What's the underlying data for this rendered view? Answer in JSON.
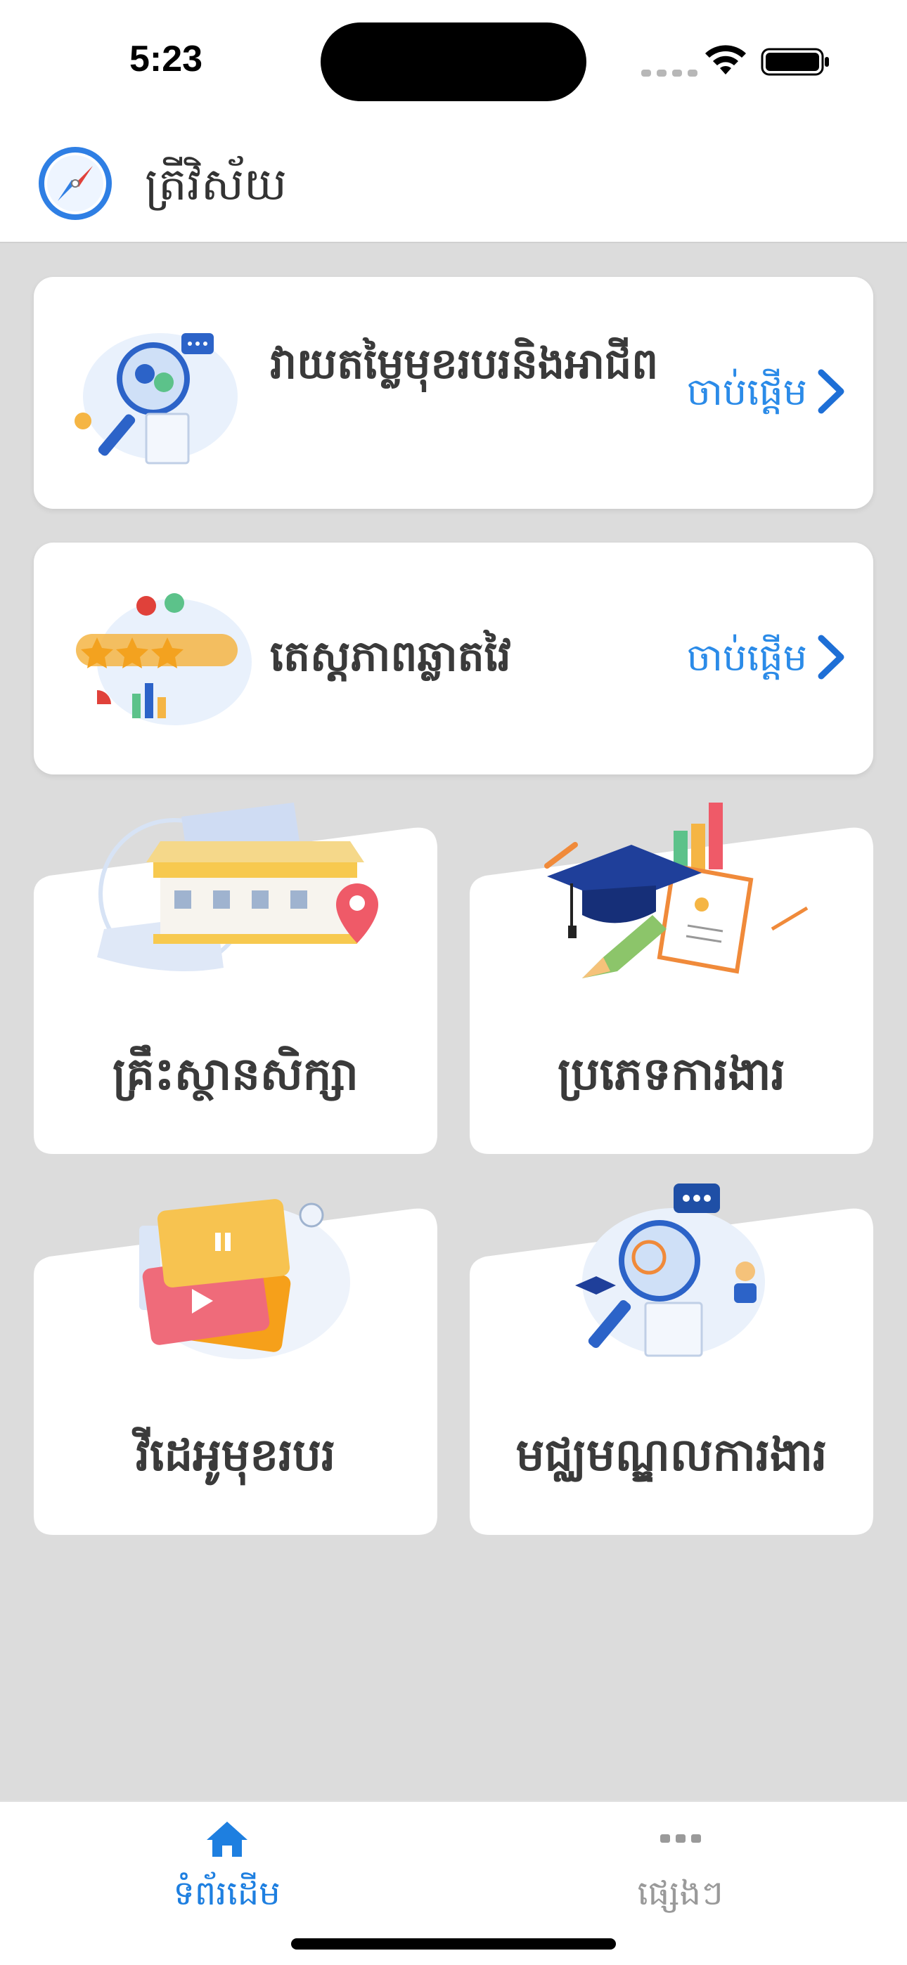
{
  "status_bar": {
    "time": "5:23"
  },
  "header": {
    "title": "ត្រីវិស័យ",
    "icon": "compass-icon"
  },
  "wide_cards": [
    {
      "title": "វាយតម្លៃមុខរបរនិងអាជីព",
      "action": "ចាប់ផ្តើម",
      "illustration": "career-assessment-illustration"
    },
    {
      "title": "តេស្តភាពឆ្លាតវៃ",
      "action": "ចាប់ផ្តើម",
      "illustration": "intelligence-test-illustration"
    }
  ],
  "grid_cards": [
    {
      "label": "គ្រឹះស្ថានសិក្សា",
      "illustration": "school-location-illustration"
    },
    {
      "label": "ប្រភេទការងារ",
      "illustration": "graduation-cap-illustration"
    },
    {
      "label": "វីដេអូមុខរបរ",
      "illustration": "video-illustration"
    },
    {
      "label": "មជ្ឈមណ្ឌលការងារ",
      "illustration": "job-center-illustration"
    }
  ],
  "tabbar": {
    "tabs": [
      {
        "label": "ទំព័រដើម",
        "icon": "home-icon",
        "active": true
      },
      {
        "label": "ផ្សេងៗ",
        "icon": "more-icon",
        "active": false
      }
    ]
  },
  "colors": {
    "accent": "#2b8be8",
    "tab_active": "#1e7fe0",
    "tab_inactive": "#9a9a9a",
    "background": "#dcdcdc"
  }
}
